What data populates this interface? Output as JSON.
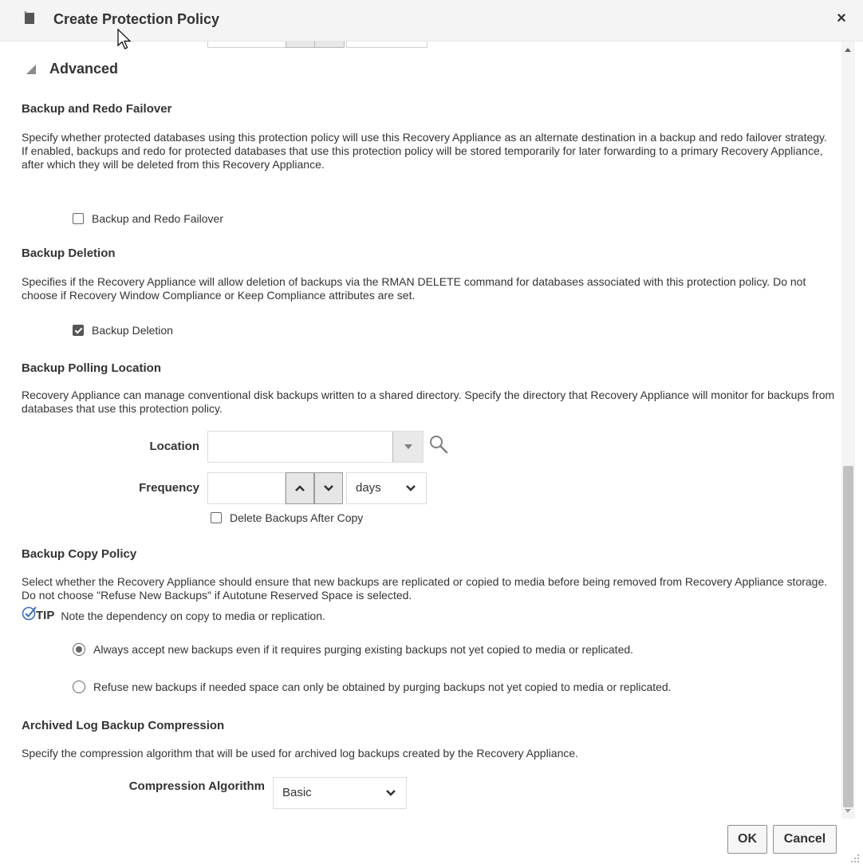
{
  "dialog": {
    "title": "Create Protection Policy",
    "close_glyph": "×",
    "title_icon": "page-new-icon"
  },
  "advanced": {
    "label": "Advanced",
    "expanded": true
  },
  "backup_redo_failover": {
    "heading": "Backup and Redo Failover",
    "description": "Specify whether protected databases using this protection policy will use this Recovery Appliance as an alternate destination in a backup and redo failover strategy. If enabled, backups and redo for protected databases that use this protection policy will be stored temporarily for later forwarding to a primary Recovery Appliance, after which they will be deleted from this Recovery Appliance.",
    "checkbox_label": "Backup and Redo Failover",
    "checked": false
  },
  "backup_deletion": {
    "heading": "Backup Deletion",
    "description": "Specifies if the Recovery Appliance will allow deletion of backups via the RMAN DELETE command for databases associated with this protection policy. Do not choose if Recovery Window Compliance or Keep Compliance attributes are set.",
    "checkbox_label": "Backup Deletion",
    "checked": true
  },
  "backup_polling": {
    "heading": "Backup Polling Location",
    "description": "Recovery Appliance can manage conventional disk backups written to a shared directory. Specify the directory that Recovery Appliance will monitor for backups from databases that use this protection policy.",
    "location_label": "Location",
    "location_value": "",
    "frequency_label": "Frequency",
    "frequency_value": "",
    "frequency_unit": "days",
    "delete_after_copy_label": "Delete Backups After Copy",
    "delete_after_copy_checked": false
  },
  "backup_copy_policy": {
    "heading": "Backup Copy Policy",
    "description": "Select whether the Recovery Appliance should ensure that new backups are replicated or copied to media before being removed from Recovery Appliance storage. Do not choose \"Refuse New Backups\" if Autotune Reserved Space is selected.",
    "tip_label": "TIP",
    "tip_text": "Note the dependency on copy to media or replication.",
    "options": [
      {
        "label": "Always accept new backups even if it requires purging existing backups not yet copied to media or replicated.",
        "selected": true
      },
      {
        "label": "Refuse new backups if needed space can only be obtained by purging backups not yet copied to media or replicated.",
        "selected": false
      }
    ]
  },
  "archived_log": {
    "heading": "Archived Log Backup Compression",
    "description": "Specify the compression algorithm that will be used for archived log backups created by the Recovery Appliance.",
    "algorithm_label": "Compression Algorithm",
    "algorithm_value": "Basic"
  },
  "footer": {
    "ok_label": "OK",
    "cancel_label": "Cancel"
  },
  "colors": {
    "titlebar_bg": "#f4f4f4",
    "text": "#333333",
    "tip_check": "#3b6fb6",
    "scroll_thumb": "#c1c1c1"
  }
}
